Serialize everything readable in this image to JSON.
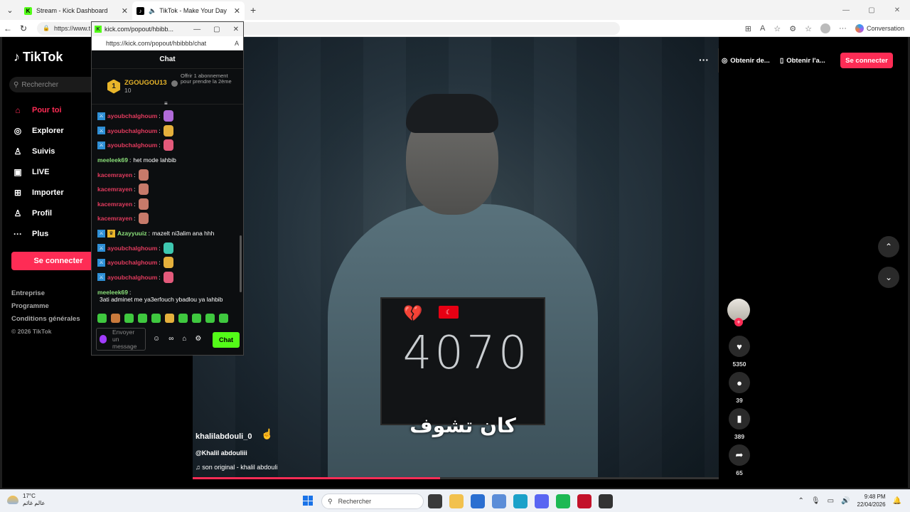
{
  "browser": {
    "tabs": [
      {
        "title": "Stream - Kick Dashboard",
        "favicon": "K"
      },
      {
        "title": "TikTok - Make Your Day",
        "favicon": "♪"
      }
    ],
    "url": "https://www.t",
    "conversation_label": "Conversation"
  },
  "popout": {
    "title_url": "kick.com/popout/hbibb...",
    "url": "https://kick.com/popout/hbibbb/chat",
    "chat_title": "Chat",
    "pinned": {
      "rank": "1",
      "gifter_name": "ZGOUGOU13",
      "gifter_count": "10",
      "offer_text": "Offrir 1 abonnement pour prendre la 2ème"
    },
    "messages": [
      {
        "user": "ayoubchalghoum",
        "color": "#e33b5e",
        "badges": [
          "sword"
        ],
        "text": "",
        "emote": "#b06ad8"
      },
      {
        "user": "ayoubchalghoum",
        "color": "#e33b5e",
        "badges": [
          "sword"
        ],
        "text": "",
        "emote": "#e5b03c"
      },
      {
        "user": "ayoubchalghoum",
        "color": "#e33b5e",
        "badges": [
          "sword"
        ],
        "text": "",
        "emote": "#e35a7b"
      },
      {
        "user": "meeleek69",
        "color": "#8be07a",
        "badges": [],
        "text": "het mode lahbib",
        "emote": ""
      },
      {
        "user": "kacemrayen",
        "color": "#e33b5e",
        "badges": [],
        "text": "",
        "emote": "#c77a6a"
      },
      {
        "user": "kacemrayen",
        "color": "#e33b5e",
        "badges": [],
        "text": "",
        "emote": "#c77a6a"
      },
      {
        "user": "kacemrayen",
        "color": "#e33b5e",
        "badges": [],
        "text": "",
        "emote": "#c77a6a"
      },
      {
        "user": "kacemrayen",
        "color": "#e33b5e",
        "badges": [],
        "text": "",
        "emote": "#c77a6a"
      },
      {
        "user": "Azayyuuiz",
        "color": "#8be07a",
        "badges": [
          "sword",
          "crown"
        ],
        "text": "mazelt ni3alim ana hhh",
        "emote": ""
      },
      {
        "user": "ayoubchalghoum",
        "color": "#e33b5e",
        "badges": [
          "sword"
        ],
        "text": "",
        "emote": "#3ec7b0"
      },
      {
        "user": "ayoubchalghoum",
        "color": "#e33b5e",
        "badges": [
          "sword"
        ],
        "text": "",
        "emote": "#e5b03c"
      },
      {
        "user": "ayoubchalghoum",
        "color": "#e33b5e",
        "badges": [
          "sword"
        ],
        "text": "",
        "emote": "#e35a7b"
      },
      {
        "user": "meeleek69",
        "color": "#8be07a",
        "badges": [],
        "text": "3ati adminet me ya3erfouch ybadlou ya lahbib",
        "emote": ""
      }
    ],
    "input_placeholder": "Envoyer un message",
    "send_label": "Chat"
  },
  "tiktok": {
    "logo": "TikTok",
    "search_placeholder": "Rechercher",
    "nav": [
      {
        "label": "Pour toi",
        "icon": "home-icon",
        "glyph": "⌂"
      },
      {
        "label": "Explorer",
        "icon": "compass-icon",
        "glyph": "◎"
      },
      {
        "label": "Suivis",
        "icon": "following-icon",
        "glyph": "♙"
      },
      {
        "label": "LIVE",
        "icon": "live-icon",
        "glyph": "▣"
      },
      {
        "label": "Importer",
        "icon": "upload-icon",
        "glyph": "⊞"
      },
      {
        "label": "Profil",
        "icon": "profile-icon",
        "glyph": "♙"
      },
      {
        "label": "Plus",
        "icon": "more-icon",
        "glyph": "···"
      }
    ],
    "connect_label": "Se connecter",
    "links": [
      "Entreprise",
      "Programme",
      "Conditions générales"
    ],
    "copyright": "© 2026 TikTok",
    "top_btn_1": "Obtenir de...",
    "top_btn_2": "Obtenir l'a...",
    "top_connect": "Se connecter",
    "video": {
      "board_number": "4070",
      "subtitle": "كان تشوف",
      "author": "khalilabdouli_0",
      "description": "@Khalil abdouliii",
      "sound": "son original - khalil abdouli",
      "progress": 0.47
    },
    "actions": {
      "likes": "5350",
      "comments": "39",
      "saves": "389",
      "shares": "65"
    }
  },
  "taskbar": {
    "temperature": "17°C",
    "weather_text": "عالم غائم",
    "search_placeholder": "Rechercher",
    "time": "9:48 PM",
    "date": "22/04/2026"
  }
}
